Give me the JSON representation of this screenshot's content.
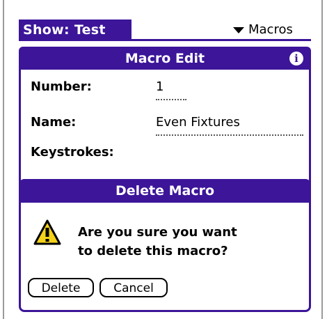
{
  "app": {
    "title": "Show: Test",
    "category": "Macros"
  },
  "form": {
    "title": "Macro Edit",
    "number_label": "Number:",
    "number_value": "1",
    "name_label": "Name:",
    "name_value": "Even Fixtures",
    "keystrokes_label": "Keystrokes:",
    "info_icon": "i"
  },
  "alert": {
    "title": "Delete Macro",
    "message_line1": "Are you sure you want",
    "message_line2": "to delete this macro?",
    "delete_label": "Delete",
    "cancel_label": "Cancel"
  },
  "colors": {
    "accent": "#3c1599",
    "warning": "#f5d21a"
  },
  "icons": {
    "info": "info-icon",
    "warning": "warning-icon",
    "dropdown": "triangle-down-icon"
  }
}
